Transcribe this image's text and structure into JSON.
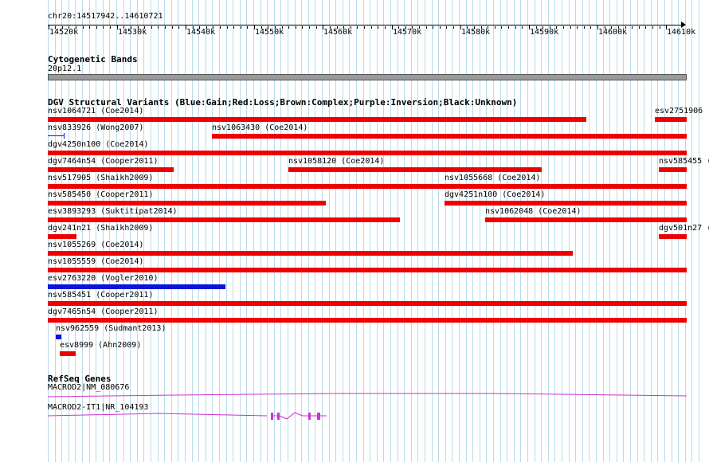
{
  "ruler": {
    "range_label": "chr20:14517942..14610721",
    "ticks": [
      "14520k",
      "14530k",
      "14540k",
      "14550k",
      "14560k",
      "14570k",
      "14580k",
      "14590k",
      "14600k",
      "14610k"
    ]
  },
  "cyto": {
    "title": "Cytogenetic Bands",
    "band": "20p12.1"
  },
  "dgv": {
    "title": "DGV Structural Variants (Blue:Gain;Red:Loss;Brown:Complex;Purple:Inversion;Black:Unknown)",
    "colors": {
      "loss": "#ee0000",
      "gain": "#0a14dd"
    },
    "features": [
      {
        "label": "nsv1064721 (Coe2014)",
        "type": "loss"
      },
      {
        "label": "esv2751906 (",
        "type": "loss"
      },
      {
        "label": "nsv833926 (Wong2007)",
        "type": "gain"
      },
      {
        "label": "nsv1063430 (Coe2014)",
        "type": "loss"
      },
      {
        "label": "dgv4250n100 (Coe2014)",
        "type": "loss"
      },
      {
        "label": "dgv7464n54 (Cooper2011)",
        "type": "loss"
      },
      {
        "label": "nsv1058120 (Coe2014)",
        "type": "loss"
      },
      {
        "label": "nsv585455 (",
        "type": "loss"
      },
      {
        "label": "nsv517905 (Shaikh2009)",
        "type": "loss"
      },
      {
        "label": "nsv1055668 (Coe2014)",
        "type": "loss"
      },
      {
        "label": "nsv585450 (Cooper2011)",
        "type": "loss"
      },
      {
        "label": "dgv4251n100 (Coe2014)",
        "type": "loss"
      },
      {
        "label": "esv3893293 (Suktitipat2014)",
        "type": "loss"
      },
      {
        "label": "nsv1062048 (Coe2014)",
        "type": "loss"
      },
      {
        "label": "dgv241n21 (Shaikh2009)",
        "type": "loss"
      },
      {
        "label": "dgv501n27 (",
        "type": "loss"
      },
      {
        "label": "nsv1055269 (Coe2014)",
        "type": "loss"
      },
      {
        "label": "nsv1055559 (Coe2014)",
        "type": "loss"
      },
      {
        "label": "esv2763220 (Vogler2010)",
        "type": "gain"
      },
      {
        "label": "nsv585451 (Cooper2011)",
        "type": "loss"
      },
      {
        "label": "dgv7465n54 (Cooper2011)",
        "type": "loss"
      },
      {
        "label": "nsv962559 (Sudmant2013)",
        "type": "gain"
      },
      {
        "label": "esv8999 (Ahn2009)",
        "type": "loss"
      }
    ]
  },
  "refseq": {
    "title": "RefSeq Genes",
    "color": "#cc33cc",
    "genes": [
      {
        "label": "MACROD2|NM_080676"
      },
      {
        "label": "MACROD2-IT1|NR_104193"
      }
    ]
  }
}
